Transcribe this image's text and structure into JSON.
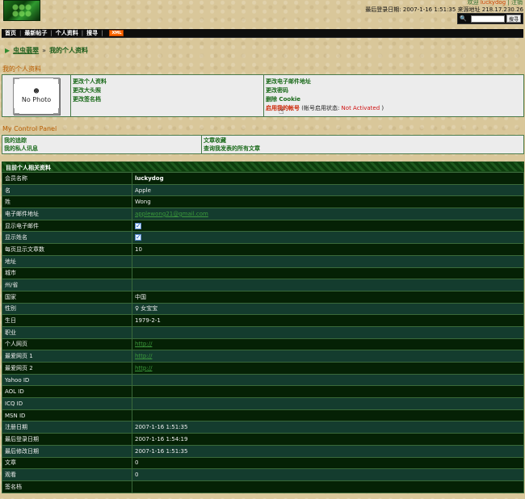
{
  "header": {
    "welcome_prefix": "欢迎",
    "username": "luckydog",
    "separator": " | ",
    "logout": "注销",
    "last_login": "最后登录日期: 2007-1-16 1:51:35 来源地址 218.17.230.26",
    "search_button": "搜寻",
    "search_placeholder": ""
  },
  "nav": {
    "items": [
      "首页",
      "最新帖子",
      "个人资料",
      "搜寻"
    ],
    "xml_badge": "XML"
  },
  "breadcrumb": {
    "home": "虫虫翡翠",
    "raquo": "»",
    "current": "我的个人资料"
  },
  "profile": {
    "section_title": "我的个人资料",
    "photo_text": "No Photo",
    "links_left": [
      "更改个人资料",
      "更改大头照",
      "更改签名档"
    ],
    "links_right": [
      "更改电子邮件地址",
      "更改密码",
      "删除 Cookie"
    ],
    "activate_link": "启用我的帐号",
    "status_prefix": " (帐号启用状态: ",
    "status_value": "Not Activated",
    "status_suffix": " )"
  },
  "control_panel": {
    "title": "My Control Panel",
    "col1": [
      "我的追踪",
      "我的私人讯息"
    ],
    "col2": [
      "文章收藏",
      "查询我发表的所有文章"
    ]
  },
  "info": {
    "header": "目前个人相关资料",
    "rows": [
      {
        "label": "会员名称",
        "value": "luckydog",
        "kind": "bold"
      },
      {
        "label": "名",
        "value": "Apple",
        "kind": "text"
      },
      {
        "label": "姓",
        "value": "Wong",
        "kind": "text"
      },
      {
        "label": "电子邮件地址",
        "value": "applewong21@gmail.com",
        "kind": "link"
      },
      {
        "label": "显示电子邮件",
        "value": "",
        "kind": "check"
      },
      {
        "label": "显示姓名",
        "value": "",
        "kind": "check"
      },
      {
        "label": "每页显示文章数",
        "value": "10",
        "kind": "text"
      },
      {
        "label": "地址",
        "value": "",
        "kind": "text"
      },
      {
        "label": "城市",
        "value": "",
        "kind": "text"
      },
      {
        "label": "州/省",
        "value": "",
        "kind": "text"
      },
      {
        "label": "国家",
        "value": "中国",
        "kind": "text"
      },
      {
        "label": "性别",
        "value": "女宝宝",
        "kind": "gender"
      },
      {
        "label": "生日",
        "value": "1979-2-1",
        "kind": "text"
      },
      {
        "label": "职业",
        "value": "",
        "kind": "text"
      },
      {
        "label": "个人网页",
        "value": "http://",
        "kind": "link"
      },
      {
        "label": "最爱网页 1",
        "value": "http://",
        "kind": "link"
      },
      {
        "label": "最爱网页 2",
        "value": "http://",
        "kind": "link"
      },
      {
        "label": "Yahoo ID",
        "value": "",
        "kind": "text"
      },
      {
        "label": "AOL ID",
        "value": "",
        "kind": "text"
      },
      {
        "label": "ICQ ID",
        "value": "",
        "kind": "text"
      },
      {
        "label": "MSN ID",
        "value": "",
        "kind": "text"
      },
      {
        "label": "注册日期",
        "value": "2007-1-16 1:51:35",
        "kind": "text"
      },
      {
        "label": "最后登录日期",
        "value": "2007-1-16 1:54:19",
        "kind": "text"
      },
      {
        "label": "最后修改日期",
        "value": "2007-1-16 1:51:35",
        "kind": "text"
      },
      {
        "label": "文章",
        "value": "0",
        "kind": "text"
      },
      {
        "label": "观看",
        "value": "0",
        "kind": "text"
      },
      {
        "label": "签名档",
        "value": "",
        "kind": "text"
      }
    ]
  },
  "colors": {
    "accent_green": "#1a6a1a",
    "table_dark": "#052105",
    "table_alt": "#143c2e",
    "status_red": "#d01010",
    "section_orange": "#b85c00"
  }
}
